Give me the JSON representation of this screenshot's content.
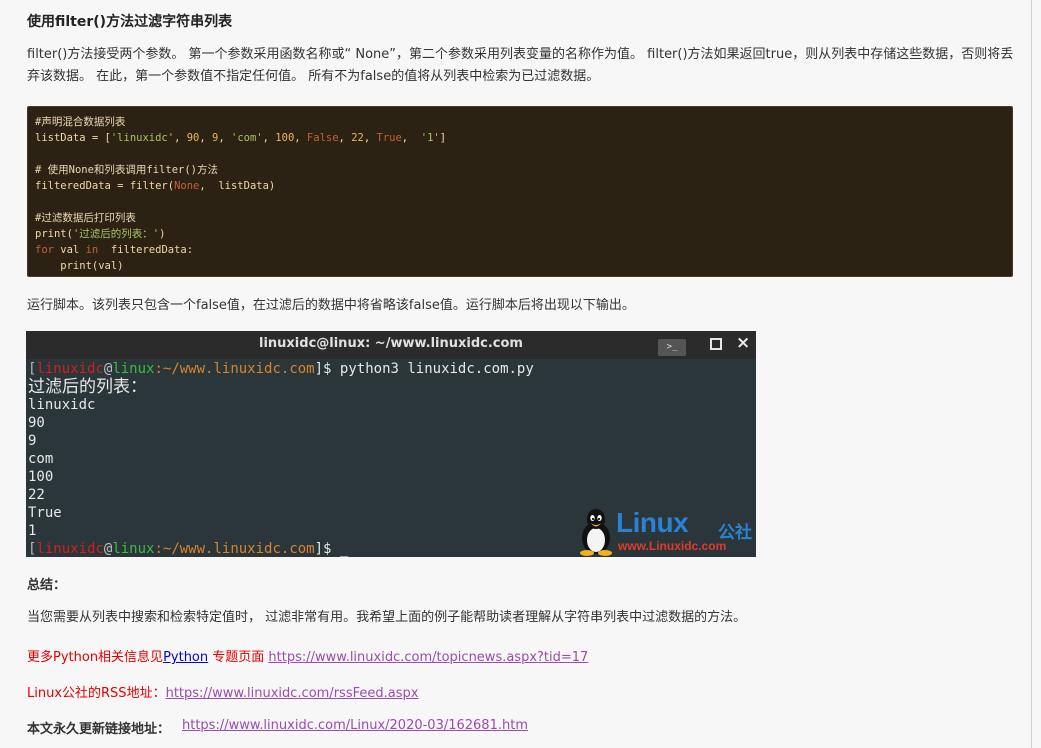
{
  "heading": "使用filter()方法过滤字符串列表",
  "para1": "filter()方法接受两个参数。 第一个参数采用函数名称或“ None”，第二个参数采用列表变量的名称作为值。 filter()方法如果返回true，则从列表中存储这些数据，否则将丢弃该数据。 在此，第一个参数值不指定任何值。 所有不为false的值将从列表中检索为已过滤数据。",
  "code": {
    "l1": "#声明混合数据列表",
    "l2a": "listData = [",
    "l2b": "'linuxidc'",
    "l2c": ", ",
    "l2d": "90",
    "l2e": ", ",
    "l2f": "9",
    "l2g": ", ",
    "l2h": "'com'",
    "l2i": ", ",
    "l2j": "100",
    "l2k": ", ",
    "l2l": "False",
    "l2m": ", ",
    "l2n": "22",
    "l2o": ", ",
    "l2p": "True",
    "l2q": ",  ",
    "l2r": "'1'",
    "l2s": "]",
    "l4": "# 使用None和列表调用filter()方法",
    "l5a": "filteredData = filter(",
    "l5b": "None",
    "l5c": ",  listData)",
    "l7": "#过滤数据后打印列表",
    "l8a": "print(",
    "l8b": "'过滤后的列表：'",
    "l8c": ")",
    "l9a": "for",
    "l9b": " val ",
    "l9c": "in",
    "l9d": "  filteredData:",
    "l10": "    print(val)"
  },
  "para2": "运行脚本。该列表只包含一个false值，在过滤后的数据中将省略该false值。运行脚本后将出现以下输出。",
  "terminal": {
    "title": "linuxidc@linux: ~/www.linuxidc.com",
    "newtab_icon": ">_",
    "prompt_open": "[",
    "user": "linuxidc",
    "at": "@",
    "host": "linux",
    "path": ":~/www.linuxidc.com",
    "prompt_close": "]$ ",
    "command": "python3 linuxidc.com.py",
    "output": [
      "过滤后的列表：",
      "linuxidc",
      "90",
      "9",
      "com",
      "100",
      "22",
      "True",
      "1"
    ],
    "cursor": "_",
    "watermark_word": "Linux",
    "watermark_cn": "公社",
    "watermark_url": "www.Linuxidc.com"
  },
  "summary_title": "总结：",
  "para3": "当您需要从列表中搜索和检索特定值时， 过滤非常有用。我希望上面的例子能帮助读者理解从字符串列表中过滤数据的方法。",
  "more": {
    "prefix": "更多Python相关信息见",
    "python_link": "Python",
    "suffix": " 专题页面 ",
    "url": "https://www.linuxidc.com/topicnews.aspx?tid=17"
  },
  "rss": {
    "label": "Linux公社的RSS地址：",
    "url": "https://www.linuxidc.com/rssFeed.aspx"
  },
  "permalink": {
    "label": "本文永久更新链接地址：",
    "url": "https://www.linuxidc.com/Linux/2020-03/162681.htm"
  }
}
